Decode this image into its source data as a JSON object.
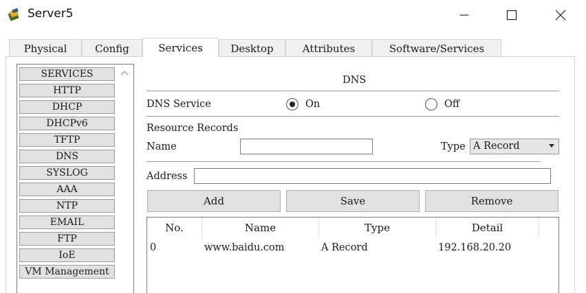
{
  "window": {
    "title": "Server5",
    "app_icon": "packet-tracer-server-icon"
  },
  "tabs": [
    {
      "label": "Physical"
    },
    {
      "label": "Config"
    },
    {
      "label": "Services",
      "active": true
    },
    {
      "label": "Desktop"
    },
    {
      "label": "Attributes"
    },
    {
      "label": "Software/Services"
    }
  ],
  "services": {
    "header": "SERVICES",
    "items": [
      "HTTP",
      "DHCP",
      "DHCPv6",
      "TFTP",
      "DNS",
      "SYSLOG",
      "AAA",
      "NTP",
      "EMAIL",
      "FTP",
      "IoE",
      "VM Management"
    ]
  },
  "dns": {
    "section_title": "DNS",
    "service_label": "DNS Service",
    "on_label": "On",
    "off_label": "Off",
    "service_state": "On",
    "records_label": "Resource Records",
    "name_label": "Name",
    "name_value": "",
    "type_label": "Type",
    "type_value": "A Record",
    "address_label": "Address",
    "address_value": "",
    "buttons": {
      "add": "Add",
      "save": "Save",
      "remove": "Remove"
    },
    "table": {
      "headers": [
        "No.",
        "Name",
        "Type",
        "Detail"
      ],
      "rows": [
        {
          "no": "0",
          "name": "www.baidu.com",
          "type": "A Record",
          "detail": "192.168.20.20"
        }
      ]
    }
  }
}
